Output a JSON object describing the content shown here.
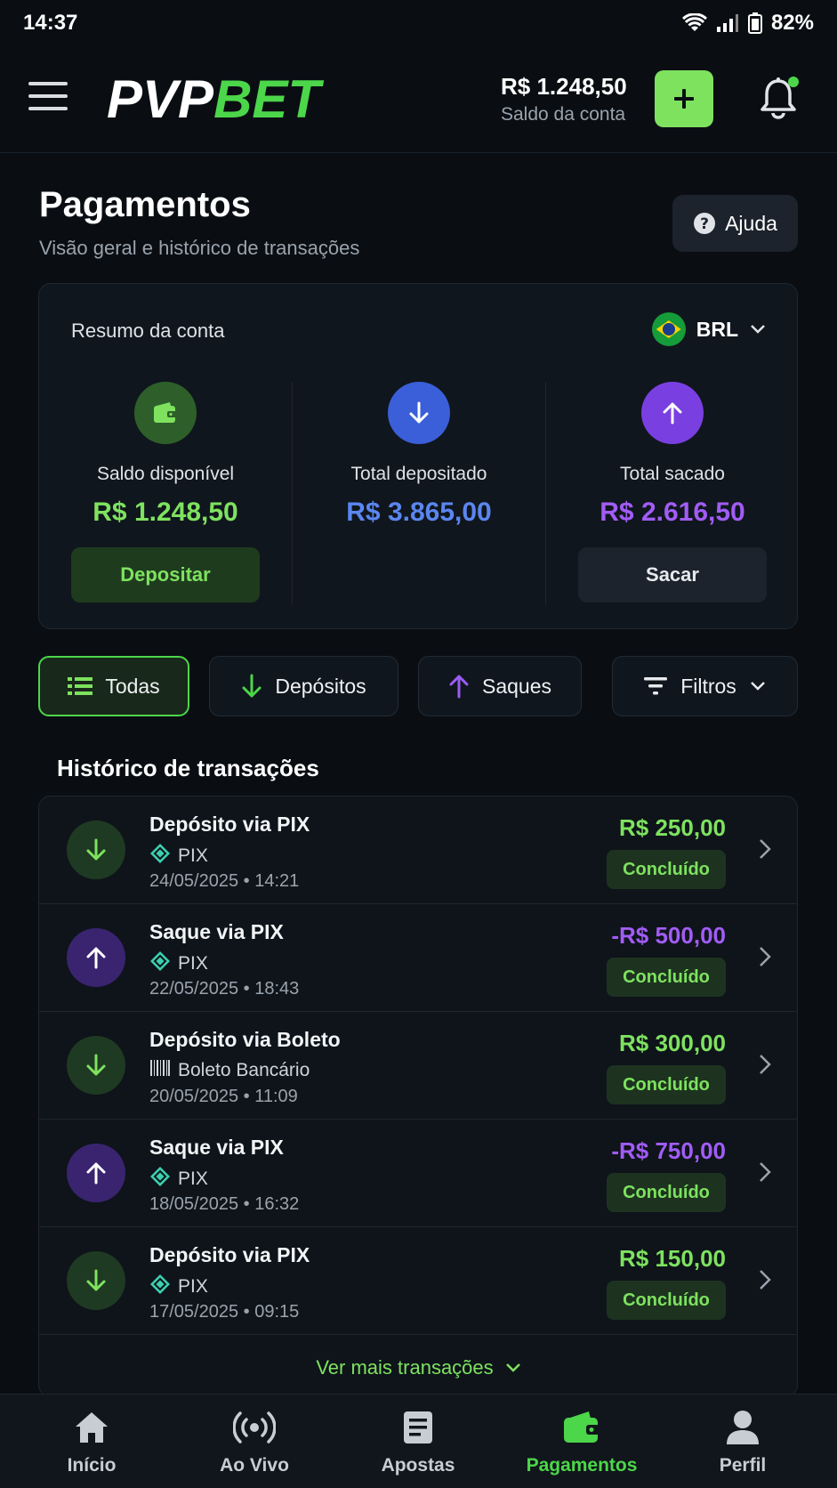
{
  "status_bar": {
    "time": "14:37",
    "battery": "82%"
  },
  "header": {
    "logo_white": "PVP",
    "logo_green": "BET",
    "balance_amount": "R$ 1.248,50",
    "balance_label": "Saldo da conta"
  },
  "page": {
    "title": "Pagamentos",
    "subtitle": "Visão geral e histórico de transações",
    "help_label": "Ajuda"
  },
  "summary": {
    "title": "Resumo da conta",
    "currency": "BRL",
    "available_label": "Saldo disponível",
    "available_value": "R$ 1.248,50",
    "deposited_label": "Total depositado",
    "deposited_value": "R$ 3.865,00",
    "withdrawn_label": "Total sacado",
    "withdrawn_value": "R$ 2.616,50",
    "deposit_button": "Depositar",
    "withdraw_button": "Sacar"
  },
  "filters": {
    "all": "Todas",
    "deposits": "Depósitos",
    "withdrawals": "Saques",
    "filters": "Filtros"
  },
  "history": {
    "title": "Histórico de transações",
    "more_label": "Ver mais transações",
    "rows": [
      {
        "type": "deposit",
        "title": "Depósito via PIX",
        "method": "PIX",
        "date": "24/05/2025 • 14:21",
        "amount": "R$ 250,00",
        "status": "Concluído"
      },
      {
        "type": "withdraw",
        "title": "Saque via PIX",
        "method": "PIX",
        "date": "22/05/2025 • 18:43",
        "amount": "-R$ 500,00",
        "status": "Concluído"
      },
      {
        "type": "deposit",
        "title": "Depósito via Boleto",
        "method": "Boleto Bancário",
        "date": "20/05/2025 • 11:09",
        "amount": "R$ 300,00",
        "status": "Concluído"
      },
      {
        "type": "withdraw",
        "title": "Saque via PIX",
        "method": "PIX",
        "date": "18/05/2025 • 16:32",
        "amount": "-R$ 750,00",
        "status": "Concluído"
      },
      {
        "type": "deposit",
        "title": "Depósito via PIX",
        "method": "PIX",
        "date": "17/05/2025 • 09:15",
        "amount": "R$ 150,00",
        "status": "Concluído"
      }
    ]
  },
  "nav": {
    "home": "Início",
    "live": "Ao Vivo",
    "bets": "Apostas",
    "payments": "Pagamentos",
    "profile": "Perfil"
  },
  "colors": {
    "accent_green": "#4cd64a",
    "deposit_blue": "#3f6fe0",
    "withdraw_purple": "#8b46e6",
    "background": "#0a0e13"
  }
}
